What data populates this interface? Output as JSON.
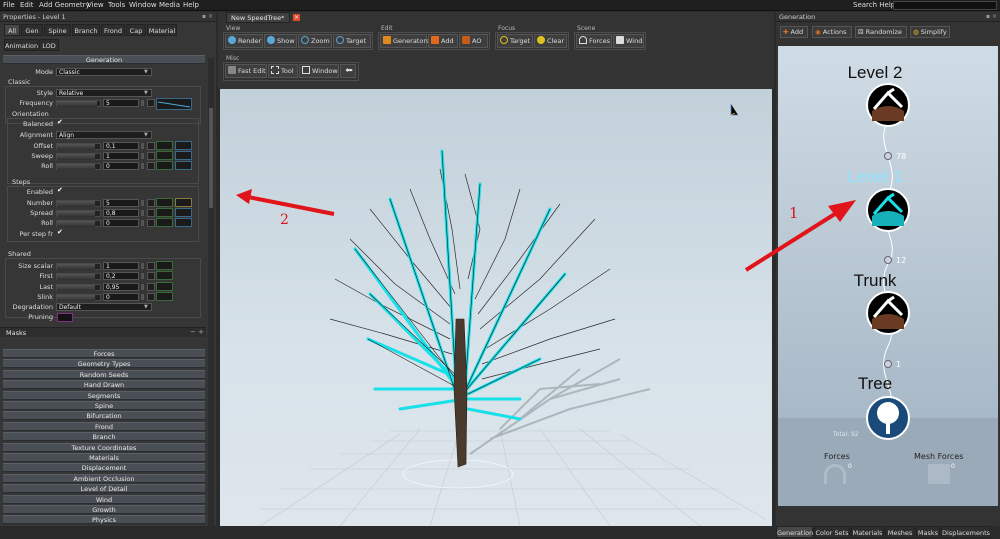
{
  "menu": [
    "File",
    "Edit",
    "Add Geometry",
    "View",
    "Tools",
    "Window",
    "Media",
    "Help"
  ],
  "search": {
    "label": "Search Help:",
    "value": ""
  },
  "properties": {
    "title": "Properties - Level 1",
    "tabs_row1": [
      "All",
      "Gen",
      "Spine",
      "Branch",
      "Frond",
      "Cap",
      "Material"
    ],
    "tabs_row2": [
      "Animation",
      "LOD"
    ],
    "section_title": "Generation",
    "mode_label": "Mode",
    "mode_value": "Classic",
    "classic_label": "Classic",
    "style_label": "Style",
    "style_value": "Relative",
    "frequency_label": "Frequency",
    "frequency_value": "5",
    "orientation_label": "Orientation",
    "balanced_label": "Balanced",
    "alignment_label": "Alignment",
    "alignment_value": "Align",
    "offset_label": "Offset",
    "offset_value": "0,1",
    "sweep_label": "Sweep",
    "sweep_value": "1",
    "roll_label": "Roll",
    "roll_value": "0",
    "steps_label": "Steps",
    "enabled_label": "Enabled",
    "number_label": "Number",
    "number_value": "5",
    "spread_label": "Spread",
    "spread_value": "0,8",
    "roll2_label": "Roll",
    "roll2_value": "0",
    "perstep_label": "Per step fr",
    "shared_label": "Shared",
    "size_scalar_label": "Size scalar",
    "size_scalar_value": "1",
    "first_label": "First",
    "first_value": "0,2",
    "last_label": "Last",
    "last_value": "0,95",
    "slink_label": "Slink",
    "slink_value": "0",
    "degradation_label": "Degradation",
    "degradation_value": "Default",
    "pruning_label": "Pruning",
    "masks_label": "Masks",
    "collapsed": [
      "Forces",
      "Geometry Types",
      "Random Seeds",
      "Hand Drawn",
      "Segments",
      "Spine",
      "Bifurcation",
      "Frond",
      "Branch",
      "Texture Coordinates",
      "Materials",
      "Displacement",
      "Ambient Occlusion",
      "Level of Detail",
      "Wind",
      "Growth",
      "Physics"
    ]
  },
  "doc_tab": "New SpeedTree*",
  "toolbar": {
    "view_label": "View",
    "view": [
      "Render",
      "Show",
      "Zoom",
      "Target"
    ],
    "edit_label": "Edit",
    "edit": [
      "Generators",
      "Add",
      "AO"
    ],
    "focus_label": "Focus",
    "focus": [
      "Target",
      "Clear"
    ],
    "scene_label": "Scene",
    "scene": [
      "Forces",
      "Wind"
    ],
    "misc_label": "Misc",
    "misc": [
      "Fast Edit",
      "Tool",
      "Window"
    ]
  },
  "generation": {
    "title": "Generation",
    "buttons": [
      "Add",
      "Actions",
      "Randomize",
      "Simplify"
    ],
    "nodes": [
      {
        "label": "Level 2"
      },
      {
        "label": "Level 1"
      },
      {
        "label": "Trunk"
      },
      {
        "label": "Tree"
      }
    ],
    "counts": [
      "78",
      "12",
      "1"
    ],
    "total": "Total: 92",
    "forces_label": "Forces",
    "forces_count": "0",
    "mesh_forces_label": "Mesh Forces",
    "mesh_forces_count": "0",
    "bottom_tabs": [
      "Generation",
      "Color Sets",
      "Materials",
      "Meshes",
      "Masks",
      "Displacements"
    ]
  },
  "annotations": {
    "label1": "1",
    "label2": "2",
    "arrow_color": "#e0141a"
  },
  "colors": {
    "accent_cyan": "#16e0e8",
    "selected_text": "#8fe3ff"
  }
}
